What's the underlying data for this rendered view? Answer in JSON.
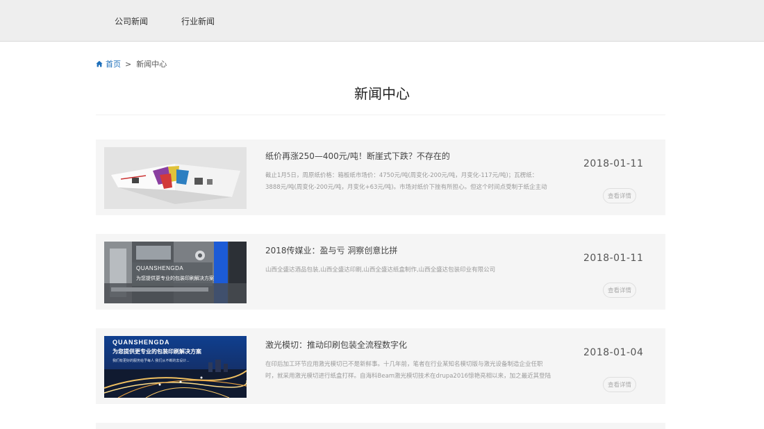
{
  "nav": {
    "items": [
      {
        "label": "公司新闻"
      },
      {
        "label": "行业新闻"
      }
    ]
  },
  "breadcrumb": {
    "home": "首页",
    "separator": ">",
    "current": "新闻中心"
  },
  "page": {
    "title": "新闻中心"
  },
  "news": [
    {
      "title": "纸价再涨250—400元/吨！断崖式下跌？不存在的",
      "summary": "截止1月5日，周原纸价格：箱板纸市场价：4750元/吨(周变化-200元/吨，月变化-117元/吨)；瓦楞纸：3888元/吨(周变化-200元/吨，月变化+63元/吨)。市场对纸价下挫有所担心。但这个时间点受制于纸企主动降价降库存避免",
      "date": "2018-01-11",
      "more": "查看详情",
      "thumb_icon": "brochure-photo"
    },
    {
      "title": "2018传媒业：盈与亏 洞察创意比拼",
      "summary": "山西全盛达酒品包装,山西全盛达印刷,山西全盛达纸盒制作,山西全盛达包装印业有限公司",
      "date": "2018-01-11",
      "more": "查看详情",
      "thumb_icon": "printing-machine-photo",
      "thumb_text": {
        "brand": "QUANSHENGDA",
        "slogan": "为您提供更专业的包装印刷解决方案"
      }
    },
    {
      "title": "激光模切：推动印刷包装全流程数字化",
      "summary": "在印后加工环节应用激光模切已不是新鲜事。十几年前，笔者在行业某知名模切版与激光设备制造企业任职时，就采用激光模切进行纸盒打样。自海科Beam激光模切技术在drupa2016惊艳亮相以来，加之最近其登陆东莞某印",
      "date": "2018-01-04",
      "more": "查看详情",
      "thumb_icon": "city-highway-night-photo",
      "thumb_text": {
        "brand": "QUANSHENGDA",
        "slogan": "为您提供更专业的包装印刷解决方案",
        "small": "我们有更好的服务给予每人 我们从不断的去设计..."
      }
    }
  ],
  "colors": {
    "accent": "#1e6fba",
    "nav_bg": "#eeeeee",
    "card_bg": "#f5f5f5"
  }
}
